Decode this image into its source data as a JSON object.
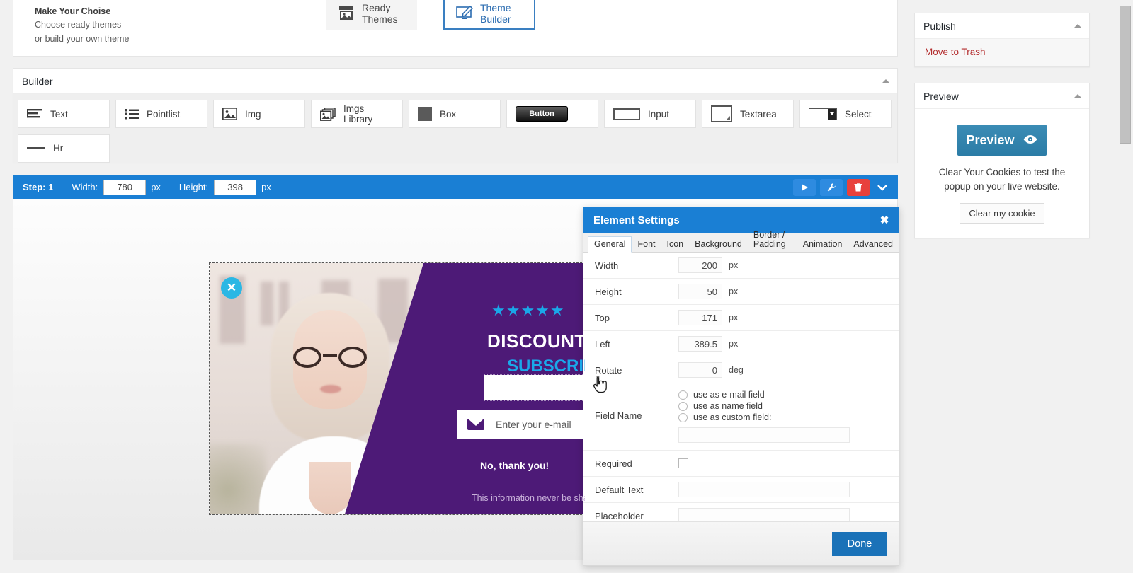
{
  "header": {
    "title": "Make Your Choise",
    "line2": "Choose ready themes",
    "line3": "or build your own theme",
    "ready_themes_label": "Ready Themes",
    "theme_builder_label": "Theme Builder"
  },
  "builder": {
    "title": "Builder",
    "elements": [
      {
        "label": "Text",
        "icon": "text-lines-icon"
      },
      {
        "label": "Pointlist",
        "icon": "bullet-list-icon"
      },
      {
        "label": "Img",
        "icon": "image-icon"
      },
      {
        "label": "Imgs Library",
        "icon": "images-stack-icon"
      },
      {
        "label": "Box",
        "icon": "filled-square-icon"
      },
      {
        "label": "Button",
        "icon": "button-glyph-icon"
      },
      {
        "label": "Input",
        "icon": "input-glyph-icon"
      },
      {
        "label": "Textarea",
        "icon": "textarea-glyph-icon"
      },
      {
        "label": "Select",
        "icon": "select-glyph-icon"
      },
      {
        "label": "Hr",
        "icon": "horizontal-rule-icon"
      }
    ]
  },
  "stepbar": {
    "step_label": "Step: 1",
    "width_label": "Width:",
    "width_value": "780",
    "width_unit": "px",
    "height_label": "Height:",
    "height_value": "398",
    "height_unit": "px",
    "tools": [
      {
        "name": "play-icon"
      },
      {
        "name": "wrench-icon"
      },
      {
        "name": "trash-icon"
      },
      {
        "name": "chevron-down-icon"
      }
    ],
    "accent_color": "#1a7fd4",
    "danger_color": "#e8413c"
  },
  "popup": {
    "close_glyph": "✕",
    "stars": "★★★★★",
    "headline": "DISCOUNT",
    "subheadline": "SUBSCRIBE",
    "email_placeholder": "Enter your e-mail",
    "no_thanks": "No, thank you!",
    "note": "This information never be shared",
    "purple": "#4d1a77",
    "cyan": "#19a9ea"
  },
  "settings": {
    "title": "Element Settings",
    "close_glyph": "✖",
    "tabs": [
      {
        "label": "General",
        "active": true
      },
      {
        "label": "Font",
        "active": false
      },
      {
        "label": "Icon",
        "active": false
      },
      {
        "label": "Background",
        "active": false
      },
      {
        "label": "Border / Padding",
        "active": false
      },
      {
        "label": "Animation",
        "active": false
      },
      {
        "label": "Advanced",
        "active": false
      }
    ],
    "fields": {
      "width_label": "Width",
      "width_value": "200",
      "width_unit": "px",
      "height_label": "Height",
      "height_value": "50",
      "height_unit": "px",
      "top_label": "Top",
      "top_value": "171",
      "top_unit": "px",
      "left_label": "Left",
      "left_value": "389.5",
      "left_unit": "px",
      "rotate_label": "Rotate",
      "rotate_value": "0",
      "rotate_unit": "deg",
      "field_name_label": "Field Name",
      "radio_email": "use as e-mail field",
      "radio_name": "use as name field",
      "radio_custom": "use as custom field:",
      "custom_field_value": "",
      "required_label": "Required",
      "default_text_label": "Default Text",
      "default_text_value": "",
      "placeholder_label": "Placeholder",
      "placeholder_value": ""
    },
    "done_label": "Done"
  },
  "sidebar": {
    "publish": {
      "title": "Publish",
      "move_to_trash": "Move to Trash"
    },
    "preview": {
      "title": "Preview",
      "button_label": "Preview",
      "button_icon": "eye-icon",
      "note": "Clear Your Cookies to test the popup on your live website.",
      "clear_cookie_label": "Clear my cookie"
    }
  }
}
